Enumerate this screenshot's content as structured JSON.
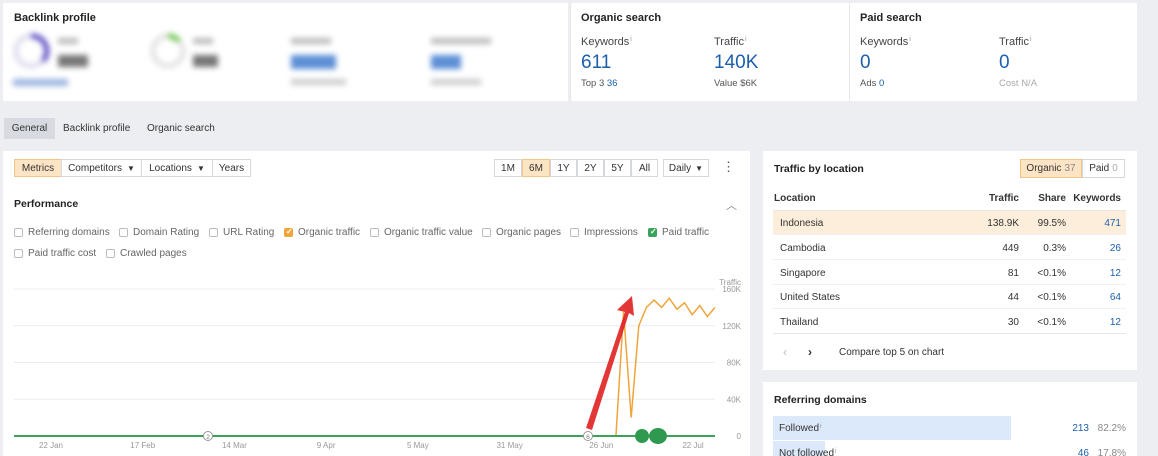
{
  "backlink_profile": {
    "title": "Backlink profile",
    "blurred": [
      "DR",
      "UR",
      "Backlinks",
      "Ref. domains",
      "34",
      "18",
      "21.9K",
      "288"
    ]
  },
  "organic_search": {
    "title": "Organic search",
    "keywords_label": "Keywords",
    "keywords_value": "611",
    "top3_label": "Top 3",
    "top3_value": "36",
    "traffic_label": "Traffic",
    "traffic_value": "140K",
    "value_label": "Value",
    "value_value": "$6K"
  },
  "paid_search": {
    "title": "Paid search",
    "keywords_label": "Keywords",
    "keywords_value": "0",
    "ads_label": "Ads",
    "ads_value": "0",
    "traffic_label": "Traffic",
    "traffic_value": "0",
    "cost_label": "Cost",
    "cost_value": "N/A"
  },
  "tabs": [
    "General",
    "Backlink profile",
    "Organic search"
  ],
  "toolbar": {
    "metrics": "Metrics",
    "competitors": "Competitors",
    "locations": "Locations",
    "years": "Years",
    "ranges": [
      "1M",
      "6M",
      "1Y",
      "2Y",
      "5Y",
      "All"
    ],
    "interval": "Daily"
  },
  "performance": {
    "title": "Performance",
    "checkboxes": [
      "Referring domains",
      "Domain Rating",
      "URL Rating",
      "Organic traffic",
      "Organic traffic value",
      "Organic pages",
      "Impressions",
      "Paid traffic",
      "Paid traffic cost",
      "Crawled pages"
    ]
  },
  "chart_data": {
    "type": "line",
    "ylabel": "Traffic",
    "y_ticks": [
      "160K",
      "120K",
      "80K",
      "40K",
      "0"
    ],
    "x_ticks": [
      "22 Jan",
      "17 Feb",
      "14 Mar",
      "9 Apr",
      "5 May",
      "31 May",
      "26 Jun",
      "22 Jul"
    ],
    "ylim": [
      0,
      160000
    ],
    "annotations": [
      "2",
      "6"
    ],
    "series": [
      {
        "color": "#f0a43a",
        "x": [
          0,
          20,
          40,
          60,
          80,
          100,
          120,
          140,
          150,
          155,
          158,
          160,
          162,
          164,
          166,
          168,
          170,
          172,
          174,
          176,
          178,
          180,
          182,
          184
        ],
        "y": [
          0,
          0,
          0,
          0,
          0,
          0,
          0,
          0,
          0,
          0,
          0,
          135000,
          20000,
          120000,
          140000,
          148000,
          140000,
          150000,
          138000,
          145000,
          132000,
          142000,
          130000,
          140000
        ]
      },
      {
        "color": "#3aa35b",
        "x": [
          0,
          184
        ],
        "y": [
          0,
          0
        ]
      }
    ]
  },
  "traffic_by_location": {
    "title": "Traffic by location",
    "organic_label": "Organic",
    "organic_count": "37",
    "paid_label": "Paid",
    "paid_count": "0",
    "headers": [
      "Location",
      "Traffic",
      "Share",
      "Keywords"
    ],
    "rows": [
      {
        "location": "Indonesia",
        "traffic": "138.9K",
        "share": "99.5%",
        "keywords": "471"
      },
      {
        "location": "Cambodia",
        "traffic": "449",
        "share": "0.3%",
        "keywords": "26"
      },
      {
        "location": "Singapore",
        "traffic": "81",
        "share": "<0.1%",
        "keywords": "12"
      },
      {
        "location": "United States",
        "traffic": "44",
        "share": "<0.1%",
        "keywords": "64"
      },
      {
        "location": "Thailand",
        "traffic": "30",
        "share": "<0.1%",
        "keywords": "12"
      }
    ],
    "compare_label": "Compare top 5 on chart"
  },
  "referring_domains": {
    "title": "Referring domains",
    "rows": [
      {
        "label": "Followed",
        "value": "213",
        "pct": "82.2%",
        "fraction": 0.822
      },
      {
        "label": "Not followed",
        "value": "46",
        "pct": "17.8%",
        "fraction": 0.178
      }
    ]
  }
}
